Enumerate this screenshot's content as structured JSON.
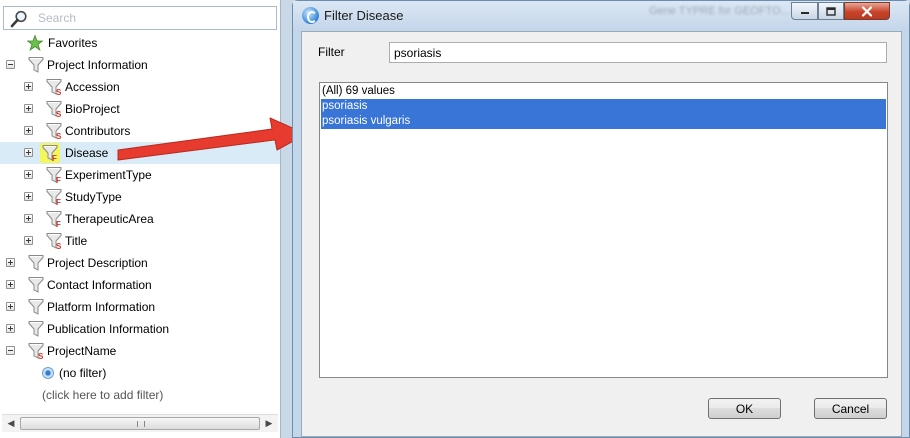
{
  "search": {
    "placeholder": "Search"
  },
  "tree": {
    "favorites": "Favorites",
    "project_information": "Project Information",
    "children": [
      "Accession",
      "BioProject",
      "Contributors",
      "Disease",
      "ExperimentType",
      "StudyType",
      "TherapeuticArea",
      "Title"
    ],
    "project_description": "Project Description",
    "contact_information": "Contact Information",
    "platform_information": "Platform Information",
    "publication_information": "Publication Information",
    "project_name": "ProjectName",
    "no_filter": "(no filter)",
    "add_filter": "(click here to add filter)"
  },
  "dialog": {
    "title": "Filter Disease",
    "background_title": "Gene TYPRE for GEOFTO...",
    "filter_label": "Filter",
    "filter_value": "psoriasis",
    "list_items": [
      "(All) 69 values",
      "psoriasis",
      "psoriasis vulgaris"
    ],
    "ok_label": "OK",
    "cancel_label": "Cancel"
  },
  "colors": {
    "selection": "#3875d7",
    "arrow": "#e63b2e",
    "highlight": "#f4f75a",
    "tree_selection": "#d9ebf7"
  },
  "icons": {
    "search": "magnifier-icon",
    "favorites": "star-icon",
    "filter": "funnel-icon",
    "filter_string": "funnel-s-icon",
    "filter_field": "funnel-f-icon"
  }
}
